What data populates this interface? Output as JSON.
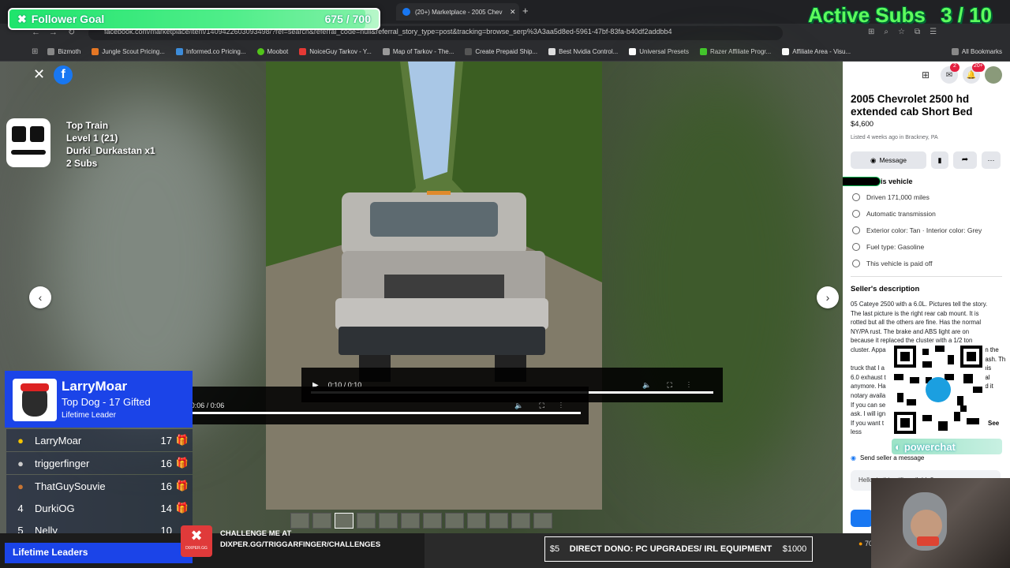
{
  "browser": {
    "tabs": [
      {
        "label": "(20+) Marketplace - 2005 Chev"
      }
    ],
    "url": "facebook.com/marketplace/item/1409422603093498/?ref=search&referral_code=null&referral_story_type=post&tracking=browse_serp%3A3aa5d8ed-5961-47bf-83fa-b40df2addbb4",
    "bookmarks": [
      "Bizmoth",
      "Jungle Scout Pricing...",
      "Informed.co Pricing...",
      "Moobot",
      "NoiceGuy Tarkov - Y...",
      "Map of Tarkov - The...",
      "Create Prepaid Ship...",
      "Best Nvidia Control...",
      "Universal Presets",
      "Razer Affiliate Progr...",
      "Affiliate Area - Visu..."
    ],
    "all_bookmarks": "All Bookmarks",
    "colors": {
      "chrome_bg": "#202124"
    }
  },
  "follower_goal": {
    "label": "Follower Goal",
    "count": "675 / 700",
    "progress": 0.964
  },
  "active_subs": {
    "label": "Active Subs",
    "value": "3 / 10"
  },
  "top_train": {
    "title": "Top Train",
    "level": "Level 1  (21)",
    "user": "Durki_Durkastan x1",
    "subs": "2 Subs"
  },
  "viewer": {
    "video_large": {
      "time": "0:10 / 0:10"
    },
    "video_small": {
      "time": "0:06 / 0:06"
    }
  },
  "listing": {
    "title": "2005 Chevrolet 2500 hd extended cab Short Bed",
    "price": "$4,600",
    "listed": "Listed 4 weeks ago in Brackney, PA",
    "message_button": "Message",
    "section_vehicle": "is vehicle",
    "features": [
      "Driven 171,000 miles",
      "Automatic transmission",
      "Exterior color: Tan · Interior color: Grey",
      "Fuel type: Gasoline",
      "This vehicle is paid off"
    ],
    "seller_desc_title": "Seller's description",
    "seller_desc": [
      "05 Cateye 2500 with a 6.0L. Pictures tell the story.",
      "The last picture is the right rear cab mount. It is",
      "rotted but all the others are fine. Has the normal",
      "NY/PA rust. The brake and ABS light are on",
      "because it replaced the cluster with a 1/2 ton",
      "cluster. Appa",
      "on the dash. Th",
      "this",
      "truck that I a",
      "nal",
      "6.0 exhaust t",
      "ed it",
      "anymore. Ha",
      "notary availa",
      "If you can se",
      "ask. I will ign",
      "If you want t",
      "less"
    ],
    "see_more": "See",
    "send_message": "Send seller a message",
    "message_placeholder": "Hello, is this still available?",
    "notification_count": "2",
    "notification_count2": "20+"
  },
  "leaderboard": {
    "top_name": "LarryMoar",
    "top_sub": "Top Dog - 17 Gifted",
    "top_role": "Lifetime Leader",
    "rows": [
      {
        "rank": "",
        "name": "LarryMoar",
        "count": "17"
      },
      {
        "rank": "",
        "name": "triggerfinger",
        "count": "16"
      },
      {
        "rank": "",
        "name": "ThatGuySouvie",
        "count": "16"
      },
      {
        "rank": "4",
        "name": "DurkiOG",
        "count": "14"
      },
      {
        "rank": "5",
        "name": "Nelly",
        "count": "10"
      }
    ],
    "footer": "Lifetime Leaders"
  },
  "challenge": {
    "line1": "CHALLENGE ME AT",
    "line2": "DIXPER.GG/TRIGGARFINGER/CHALLENGES",
    "logo": "DIXPER.GG"
  },
  "dono": {
    "min": "$5",
    "text": "DIRECT DONO: PC UPGRADES/ IRL EQUIPMENT",
    "max": "$1000"
  },
  "powerchat": {
    "label": "powerchat"
  },
  "weather": "70°"
}
